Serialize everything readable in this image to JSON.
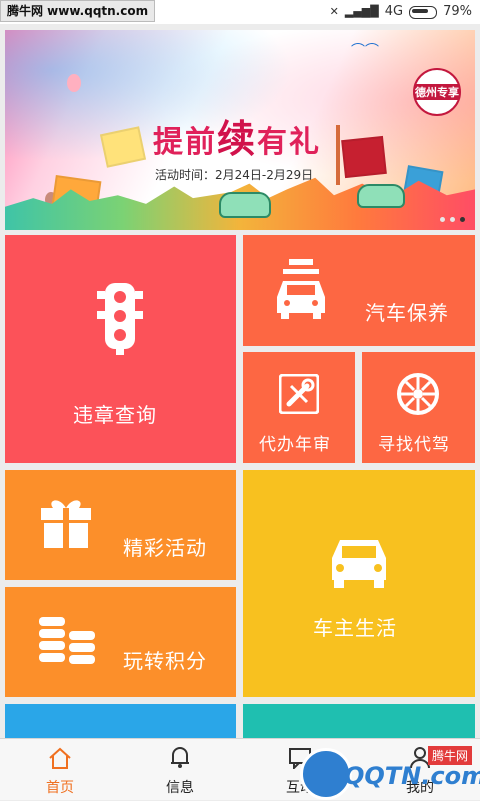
{
  "status": {
    "watermark": "腾牛网 www.qqtn.com",
    "network": "4G",
    "battery": "79%"
  },
  "banner": {
    "title_prefix": "提前",
    "title_big": "续",
    "title_suffix": "有礼",
    "date": "活动时间：2月24日-2月29日",
    "badge": "德州专享"
  },
  "tiles": {
    "violation": {
      "label": "违章查询",
      "color": "#fc5259"
    },
    "maintenance": {
      "label": "汽车保养",
      "color": "#fd6743"
    },
    "inspection": {
      "label": "代办年审",
      "color": "#fd6743"
    },
    "driver": {
      "label": "寻找代驾",
      "color": "#fd6743"
    },
    "activities": {
      "label": "精彩活动",
      "color": "#fc8f2a"
    },
    "points": {
      "label": "玩转积分",
      "color": "#fc8f2a"
    },
    "life": {
      "label": "车主生活",
      "color": "#f8c11f"
    }
  },
  "nav": {
    "home": "首页",
    "messages": "信息",
    "interact": "互动",
    "mine": "我的"
  },
  "watermark_bottom": {
    "brand": "QQTN.com",
    "cn": "腾牛网"
  }
}
